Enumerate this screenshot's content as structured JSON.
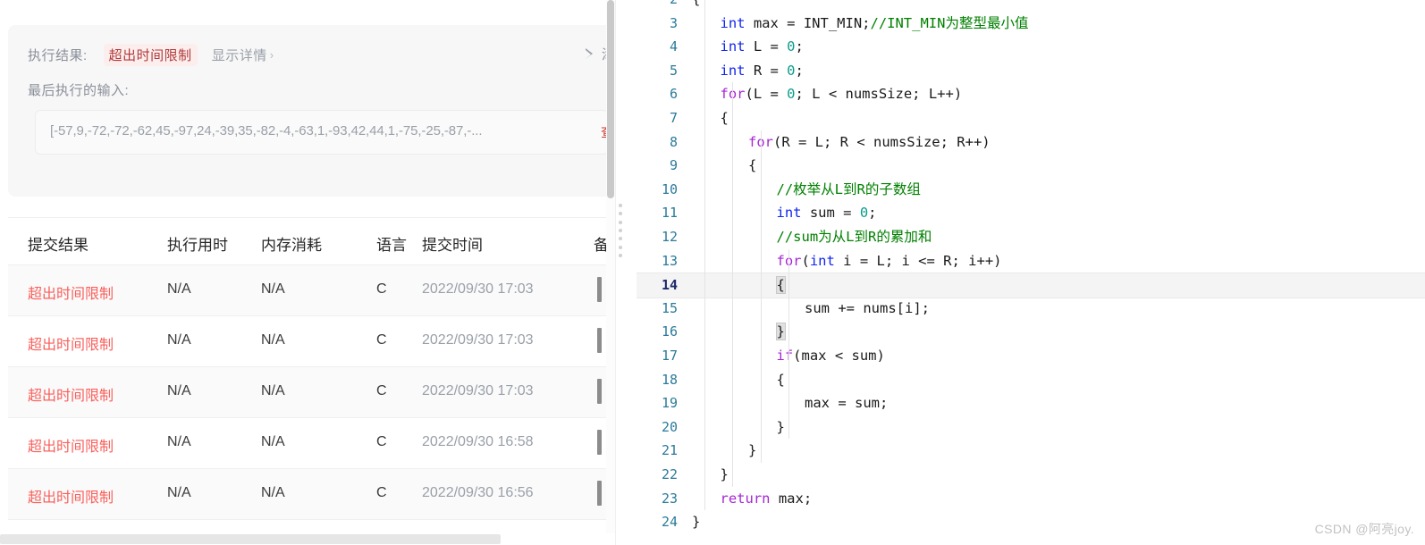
{
  "result_card": {
    "result_label": "执行结果:",
    "result_status": "超出时间限制",
    "detail_link": "显示详情",
    "detail_chevron": "›",
    "add_note_label": "添加备",
    "last_input_label": "最后执行的输入:",
    "last_input_value": "[-57,9,-72,-72,-62,45,-97,24,-39,35,-82,-4,-63,1,-93,42,44,1,-75,-25,-87,-...",
    "view_link": "查看",
    "status_color": "#b03a3a",
    "status_bg": "#fdeeee"
  },
  "submissions": {
    "headers": [
      "提交结果",
      "执行用时",
      "内存消耗",
      "语言",
      "提交时间",
      "备"
    ],
    "rows": [
      {
        "status": "超出时间限制",
        "runtime": "N/A",
        "memory": "N/A",
        "lang": "C",
        "time": "2022/09/30 17:03"
      },
      {
        "status": "超出时间限制",
        "runtime": "N/A",
        "memory": "N/A",
        "lang": "C",
        "time": "2022/09/30 17:03"
      },
      {
        "status": "超出时间限制",
        "runtime": "N/A",
        "memory": "N/A",
        "lang": "C",
        "time": "2022/09/30 17:03"
      },
      {
        "status": "超出时间限制",
        "runtime": "N/A",
        "memory": "N/A",
        "lang": "C",
        "time": "2022/09/30 16:58"
      },
      {
        "status": "超出时间限制",
        "runtime": "N/A",
        "memory": "N/A",
        "lang": "C",
        "time": "2022/09/30 16:56"
      }
    ],
    "status_color": "#f8615c"
  },
  "code": {
    "language": "C",
    "first_visible_line": 2,
    "active_line": 14,
    "lines": [
      {
        "n": 2,
        "indent": 0,
        "tokens": [
          {
            "t": "{",
            "c": "plain"
          }
        ]
      },
      {
        "n": 3,
        "indent": 1,
        "tokens": [
          {
            "t": "int",
            "c": "ty"
          },
          {
            "t": " max = INT_MIN;",
            "c": "plain"
          },
          {
            "t": "//INT_MIN为整型最小值",
            "c": "cmt"
          }
        ]
      },
      {
        "n": 4,
        "indent": 1,
        "tokens": [
          {
            "t": "int",
            "c": "ty"
          },
          {
            "t": " L = ",
            "c": "plain"
          },
          {
            "t": "0",
            "c": "num"
          },
          {
            "t": ";",
            "c": "plain"
          }
        ]
      },
      {
        "n": 5,
        "indent": 1,
        "tokens": [
          {
            "t": "int",
            "c": "ty"
          },
          {
            "t": " R = ",
            "c": "plain"
          },
          {
            "t": "0",
            "c": "num"
          },
          {
            "t": ";",
            "c": "plain"
          }
        ]
      },
      {
        "n": 6,
        "indent": 1,
        "tokens": [
          {
            "t": "for",
            "c": "kw"
          },
          {
            "t": "(L = ",
            "c": "plain"
          },
          {
            "t": "0",
            "c": "num"
          },
          {
            "t": "; L < numsSize; L++)",
            "c": "plain"
          }
        ]
      },
      {
        "n": 7,
        "indent": 1,
        "tokens": [
          {
            "t": "{",
            "c": "plain"
          }
        ]
      },
      {
        "n": 8,
        "indent": 2,
        "tokens": [
          {
            "t": "for",
            "c": "kw"
          },
          {
            "t": "(R = L; R < numsSize; R++)",
            "c": "plain"
          }
        ]
      },
      {
        "n": 9,
        "indent": 2,
        "tokens": [
          {
            "t": "{",
            "c": "plain"
          }
        ]
      },
      {
        "n": 10,
        "indent": 3,
        "tokens": [
          {
            "t": "//枚举从L到R的子数组",
            "c": "cmt"
          }
        ]
      },
      {
        "n": 11,
        "indent": 3,
        "tokens": [
          {
            "t": "int",
            "c": "ty"
          },
          {
            "t": " sum = ",
            "c": "plain"
          },
          {
            "t": "0",
            "c": "num"
          },
          {
            "t": ";",
            "c": "plain"
          }
        ]
      },
      {
        "n": 12,
        "indent": 3,
        "tokens": [
          {
            "t": "//sum为从L到R的累加和",
            "c": "cmt"
          }
        ]
      },
      {
        "n": 13,
        "indent": 3,
        "tokens": [
          {
            "t": "for",
            "c": "kw"
          },
          {
            "t": "(",
            "c": "plain"
          },
          {
            "t": "int",
            "c": "ty"
          },
          {
            "t": " i = L; i <= R; i++)",
            "c": "plain"
          }
        ]
      },
      {
        "n": 14,
        "indent": 3,
        "tokens": [
          {
            "t": "{",
            "c": "brace"
          }
        ]
      },
      {
        "n": 15,
        "indent": 4,
        "tokens": [
          {
            "t": "sum += nums[i];",
            "c": "plain"
          }
        ]
      },
      {
        "n": 16,
        "indent": 3,
        "tokens": [
          {
            "t": "}",
            "c": "brace"
          }
        ]
      },
      {
        "n": 17,
        "indent": 3,
        "tokens": [
          {
            "t": "if",
            "c": "kw"
          },
          {
            "t": "(max < sum)",
            "c": "plain"
          }
        ]
      },
      {
        "n": 18,
        "indent": 3,
        "tokens": [
          {
            "t": "{",
            "c": "plain"
          }
        ]
      },
      {
        "n": 19,
        "indent": 4,
        "tokens": [
          {
            "t": "max = sum;",
            "c": "plain"
          }
        ]
      },
      {
        "n": 20,
        "indent": 3,
        "tokens": [
          {
            "t": "}",
            "c": "plain"
          }
        ]
      },
      {
        "n": 21,
        "indent": 2,
        "tokens": [
          {
            "t": "}",
            "c": "plain"
          }
        ]
      },
      {
        "n": 22,
        "indent": 1,
        "tokens": [
          {
            "t": "}",
            "c": "plain"
          }
        ]
      },
      {
        "n": 23,
        "indent": 1,
        "tokens": [
          {
            "t": "return",
            "c": "kw"
          },
          {
            "t": " max;",
            "c": "plain"
          }
        ]
      },
      {
        "n": 24,
        "indent": 0,
        "tokens": [
          {
            "t": "}",
            "c": "plain"
          }
        ]
      }
    ],
    "colors": {
      "keyword": "#a626d4",
      "type": "#1226ec",
      "comment": "#008000",
      "number": "#0a9c8a",
      "linenumber": "#2b7a9b"
    }
  },
  "watermark": "CSDN @阿亮joy."
}
